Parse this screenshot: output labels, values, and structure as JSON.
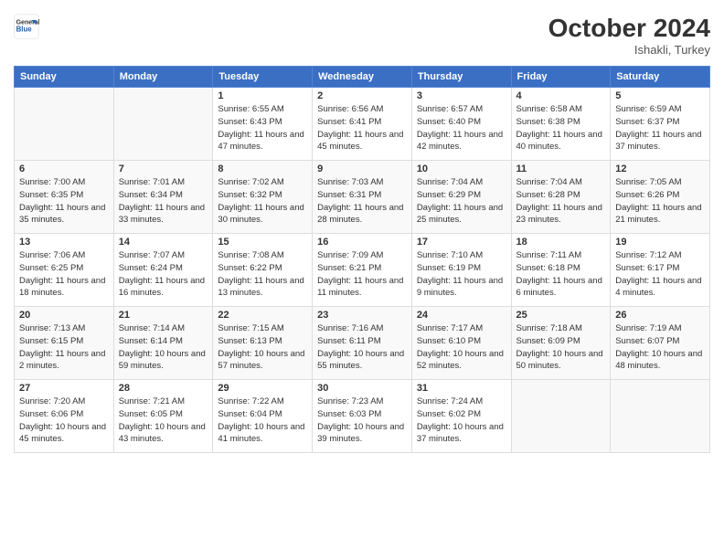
{
  "header": {
    "logo_line1": "General",
    "logo_line2": "Blue",
    "month_title": "October 2024",
    "location": "Ishakli, Turkey"
  },
  "days_of_week": [
    "Sunday",
    "Monday",
    "Tuesday",
    "Wednesday",
    "Thursday",
    "Friday",
    "Saturday"
  ],
  "weeks": [
    [
      {
        "day": "",
        "sunrise": "",
        "sunset": "",
        "daylight": ""
      },
      {
        "day": "",
        "sunrise": "",
        "sunset": "",
        "daylight": ""
      },
      {
        "day": "1",
        "sunrise": "Sunrise: 6:55 AM",
        "sunset": "Sunset: 6:43 PM",
        "daylight": "Daylight: 11 hours and 47 minutes."
      },
      {
        "day": "2",
        "sunrise": "Sunrise: 6:56 AM",
        "sunset": "Sunset: 6:41 PM",
        "daylight": "Daylight: 11 hours and 45 minutes."
      },
      {
        "day": "3",
        "sunrise": "Sunrise: 6:57 AM",
        "sunset": "Sunset: 6:40 PM",
        "daylight": "Daylight: 11 hours and 42 minutes."
      },
      {
        "day": "4",
        "sunrise": "Sunrise: 6:58 AM",
        "sunset": "Sunset: 6:38 PM",
        "daylight": "Daylight: 11 hours and 40 minutes."
      },
      {
        "day": "5",
        "sunrise": "Sunrise: 6:59 AM",
        "sunset": "Sunset: 6:37 PM",
        "daylight": "Daylight: 11 hours and 37 minutes."
      }
    ],
    [
      {
        "day": "6",
        "sunrise": "Sunrise: 7:00 AM",
        "sunset": "Sunset: 6:35 PM",
        "daylight": "Daylight: 11 hours and 35 minutes."
      },
      {
        "day": "7",
        "sunrise": "Sunrise: 7:01 AM",
        "sunset": "Sunset: 6:34 PM",
        "daylight": "Daylight: 11 hours and 33 minutes."
      },
      {
        "day": "8",
        "sunrise": "Sunrise: 7:02 AM",
        "sunset": "Sunset: 6:32 PM",
        "daylight": "Daylight: 11 hours and 30 minutes."
      },
      {
        "day": "9",
        "sunrise": "Sunrise: 7:03 AM",
        "sunset": "Sunset: 6:31 PM",
        "daylight": "Daylight: 11 hours and 28 minutes."
      },
      {
        "day": "10",
        "sunrise": "Sunrise: 7:04 AM",
        "sunset": "Sunset: 6:29 PM",
        "daylight": "Daylight: 11 hours and 25 minutes."
      },
      {
        "day": "11",
        "sunrise": "Sunrise: 7:04 AM",
        "sunset": "Sunset: 6:28 PM",
        "daylight": "Daylight: 11 hours and 23 minutes."
      },
      {
        "day": "12",
        "sunrise": "Sunrise: 7:05 AM",
        "sunset": "Sunset: 6:26 PM",
        "daylight": "Daylight: 11 hours and 21 minutes."
      }
    ],
    [
      {
        "day": "13",
        "sunrise": "Sunrise: 7:06 AM",
        "sunset": "Sunset: 6:25 PM",
        "daylight": "Daylight: 11 hours and 18 minutes."
      },
      {
        "day": "14",
        "sunrise": "Sunrise: 7:07 AM",
        "sunset": "Sunset: 6:24 PM",
        "daylight": "Daylight: 11 hours and 16 minutes."
      },
      {
        "day": "15",
        "sunrise": "Sunrise: 7:08 AM",
        "sunset": "Sunset: 6:22 PM",
        "daylight": "Daylight: 11 hours and 13 minutes."
      },
      {
        "day": "16",
        "sunrise": "Sunrise: 7:09 AM",
        "sunset": "Sunset: 6:21 PM",
        "daylight": "Daylight: 11 hours and 11 minutes."
      },
      {
        "day": "17",
        "sunrise": "Sunrise: 7:10 AM",
        "sunset": "Sunset: 6:19 PM",
        "daylight": "Daylight: 11 hours and 9 minutes."
      },
      {
        "day": "18",
        "sunrise": "Sunrise: 7:11 AM",
        "sunset": "Sunset: 6:18 PM",
        "daylight": "Daylight: 11 hours and 6 minutes."
      },
      {
        "day": "19",
        "sunrise": "Sunrise: 7:12 AM",
        "sunset": "Sunset: 6:17 PM",
        "daylight": "Daylight: 11 hours and 4 minutes."
      }
    ],
    [
      {
        "day": "20",
        "sunrise": "Sunrise: 7:13 AM",
        "sunset": "Sunset: 6:15 PM",
        "daylight": "Daylight: 11 hours and 2 minutes."
      },
      {
        "day": "21",
        "sunrise": "Sunrise: 7:14 AM",
        "sunset": "Sunset: 6:14 PM",
        "daylight": "Daylight: 10 hours and 59 minutes."
      },
      {
        "day": "22",
        "sunrise": "Sunrise: 7:15 AM",
        "sunset": "Sunset: 6:13 PM",
        "daylight": "Daylight: 10 hours and 57 minutes."
      },
      {
        "day": "23",
        "sunrise": "Sunrise: 7:16 AM",
        "sunset": "Sunset: 6:11 PM",
        "daylight": "Daylight: 10 hours and 55 minutes."
      },
      {
        "day": "24",
        "sunrise": "Sunrise: 7:17 AM",
        "sunset": "Sunset: 6:10 PM",
        "daylight": "Daylight: 10 hours and 52 minutes."
      },
      {
        "day": "25",
        "sunrise": "Sunrise: 7:18 AM",
        "sunset": "Sunset: 6:09 PM",
        "daylight": "Daylight: 10 hours and 50 minutes."
      },
      {
        "day": "26",
        "sunrise": "Sunrise: 7:19 AM",
        "sunset": "Sunset: 6:07 PM",
        "daylight": "Daylight: 10 hours and 48 minutes."
      }
    ],
    [
      {
        "day": "27",
        "sunrise": "Sunrise: 7:20 AM",
        "sunset": "Sunset: 6:06 PM",
        "daylight": "Daylight: 10 hours and 45 minutes."
      },
      {
        "day": "28",
        "sunrise": "Sunrise: 7:21 AM",
        "sunset": "Sunset: 6:05 PM",
        "daylight": "Daylight: 10 hours and 43 minutes."
      },
      {
        "day": "29",
        "sunrise": "Sunrise: 7:22 AM",
        "sunset": "Sunset: 6:04 PM",
        "daylight": "Daylight: 10 hours and 41 minutes."
      },
      {
        "day": "30",
        "sunrise": "Sunrise: 7:23 AM",
        "sunset": "Sunset: 6:03 PM",
        "daylight": "Daylight: 10 hours and 39 minutes."
      },
      {
        "day": "31",
        "sunrise": "Sunrise: 7:24 AM",
        "sunset": "Sunset: 6:02 PM",
        "daylight": "Daylight: 10 hours and 37 minutes."
      },
      {
        "day": "",
        "sunrise": "",
        "sunset": "",
        "daylight": ""
      },
      {
        "day": "",
        "sunrise": "",
        "sunset": "",
        "daylight": ""
      }
    ]
  ]
}
